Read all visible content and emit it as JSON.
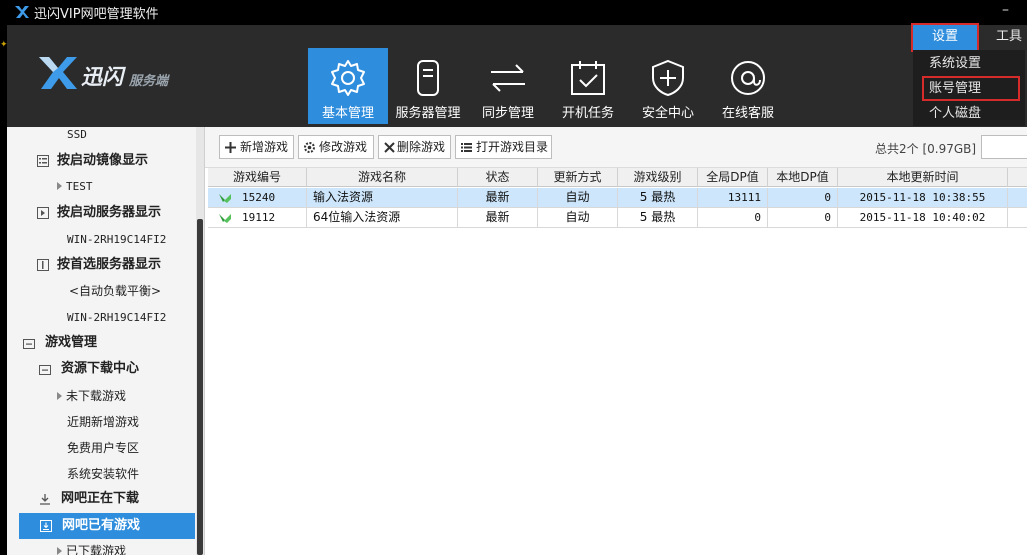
{
  "window": {
    "title": "迅闪VIP网吧管理软件",
    "minimize_glyph": "–"
  },
  "brand": {
    "main": "迅闪",
    "sub": "服务端"
  },
  "nav": [
    {
      "label": "基本管理",
      "icon": "gear-icon",
      "active": true
    },
    {
      "label": "服务器管理",
      "icon": "server-icon",
      "active": false
    },
    {
      "label": "同步管理",
      "icon": "sync-arrows-icon",
      "active": false
    },
    {
      "label": "开机任务",
      "icon": "calendar-check-icon",
      "active": false
    },
    {
      "label": "安全中心",
      "icon": "shield-plus-icon",
      "active": false
    },
    {
      "label": "在线客服",
      "icon": "at-sign-icon",
      "active": false
    }
  ],
  "topmenu": {
    "settings": "设置",
    "tools": "工具"
  },
  "dropdown": {
    "items": [
      "系统设置",
      "账号管理",
      "个人磁盘"
    ]
  },
  "sidebar": {
    "items": [
      {
        "label": "SSD",
        "style": "mono"
      },
      {
        "label": "按启动镜像显示",
        "style": "bold",
        "icon": "list-icon"
      },
      {
        "label": "TEST",
        "style": "mono",
        "arrow": true
      },
      {
        "label": "按启动服务器显示",
        "style": "bold",
        "icon": "server-play-icon"
      },
      {
        "label": "WIN-2RH19C14FI2",
        "style": "mono"
      },
      {
        "label": "按首选服务器显示",
        "style": "bold",
        "icon": "server-doc-icon"
      },
      {
        "label": "<自动负载平衡>",
        "style": "normal"
      },
      {
        "label": "WIN-2RH19C14FI2",
        "style": "mono"
      },
      {
        "label": "游戏管理",
        "style": "bold",
        "icon": "collapse-icon"
      },
      {
        "label": "资源下载中心",
        "style": "bold",
        "icon": "collapse-icon"
      },
      {
        "label": "未下载游戏",
        "style": "normal",
        "arrow": true
      },
      {
        "label": "近期新增游戏",
        "style": "normal"
      },
      {
        "label": "免费用户专区",
        "style": "normal"
      },
      {
        "label": "系统安装软件",
        "style": "normal"
      },
      {
        "label": "网吧正在下载",
        "style": "bold",
        "icon": "download-icon"
      },
      {
        "label": "网吧已有游戏",
        "style": "bold",
        "icon": "installed-icon",
        "selected": true
      },
      {
        "label": "已下载游戏",
        "style": "normal",
        "arrow": true
      }
    ]
  },
  "toolbar": {
    "add": "新增游戏",
    "edit": "修改游戏",
    "delete": "删除游戏",
    "open_dir": "打开游戏目录",
    "total": "总共2个 [0.97GB]"
  },
  "table": {
    "columns": [
      "游戏编号",
      "游戏名称",
      "状态",
      "更新方式",
      "游戏级别",
      "全局DP值",
      "本地DP值",
      "本地更新时间"
    ],
    "rows": [
      {
        "id": "15240",
        "name": "输入法资源",
        "status": "最新",
        "update": "自动",
        "level": "5 最热",
        "global_dp": "13111",
        "local_dp": "0",
        "time": "2015-11-18 10:38:55",
        "selected": true
      },
      {
        "id": "19112",
        "name": "64位输入法资源",
        "status": "最新",
        "update": "自动",
        "level": "5 最热",
        "global_dp": "0",
        "local_dp": "0",
        "time": "2015-11-18 10:40:02",
        "selected": false
      }
    ]
  },
  "colors": {
    "accent": "#2e8ddc",
    "highlight_box": "#d62b2b",
    "header_bg": "#2b2b2b"
  }
}
